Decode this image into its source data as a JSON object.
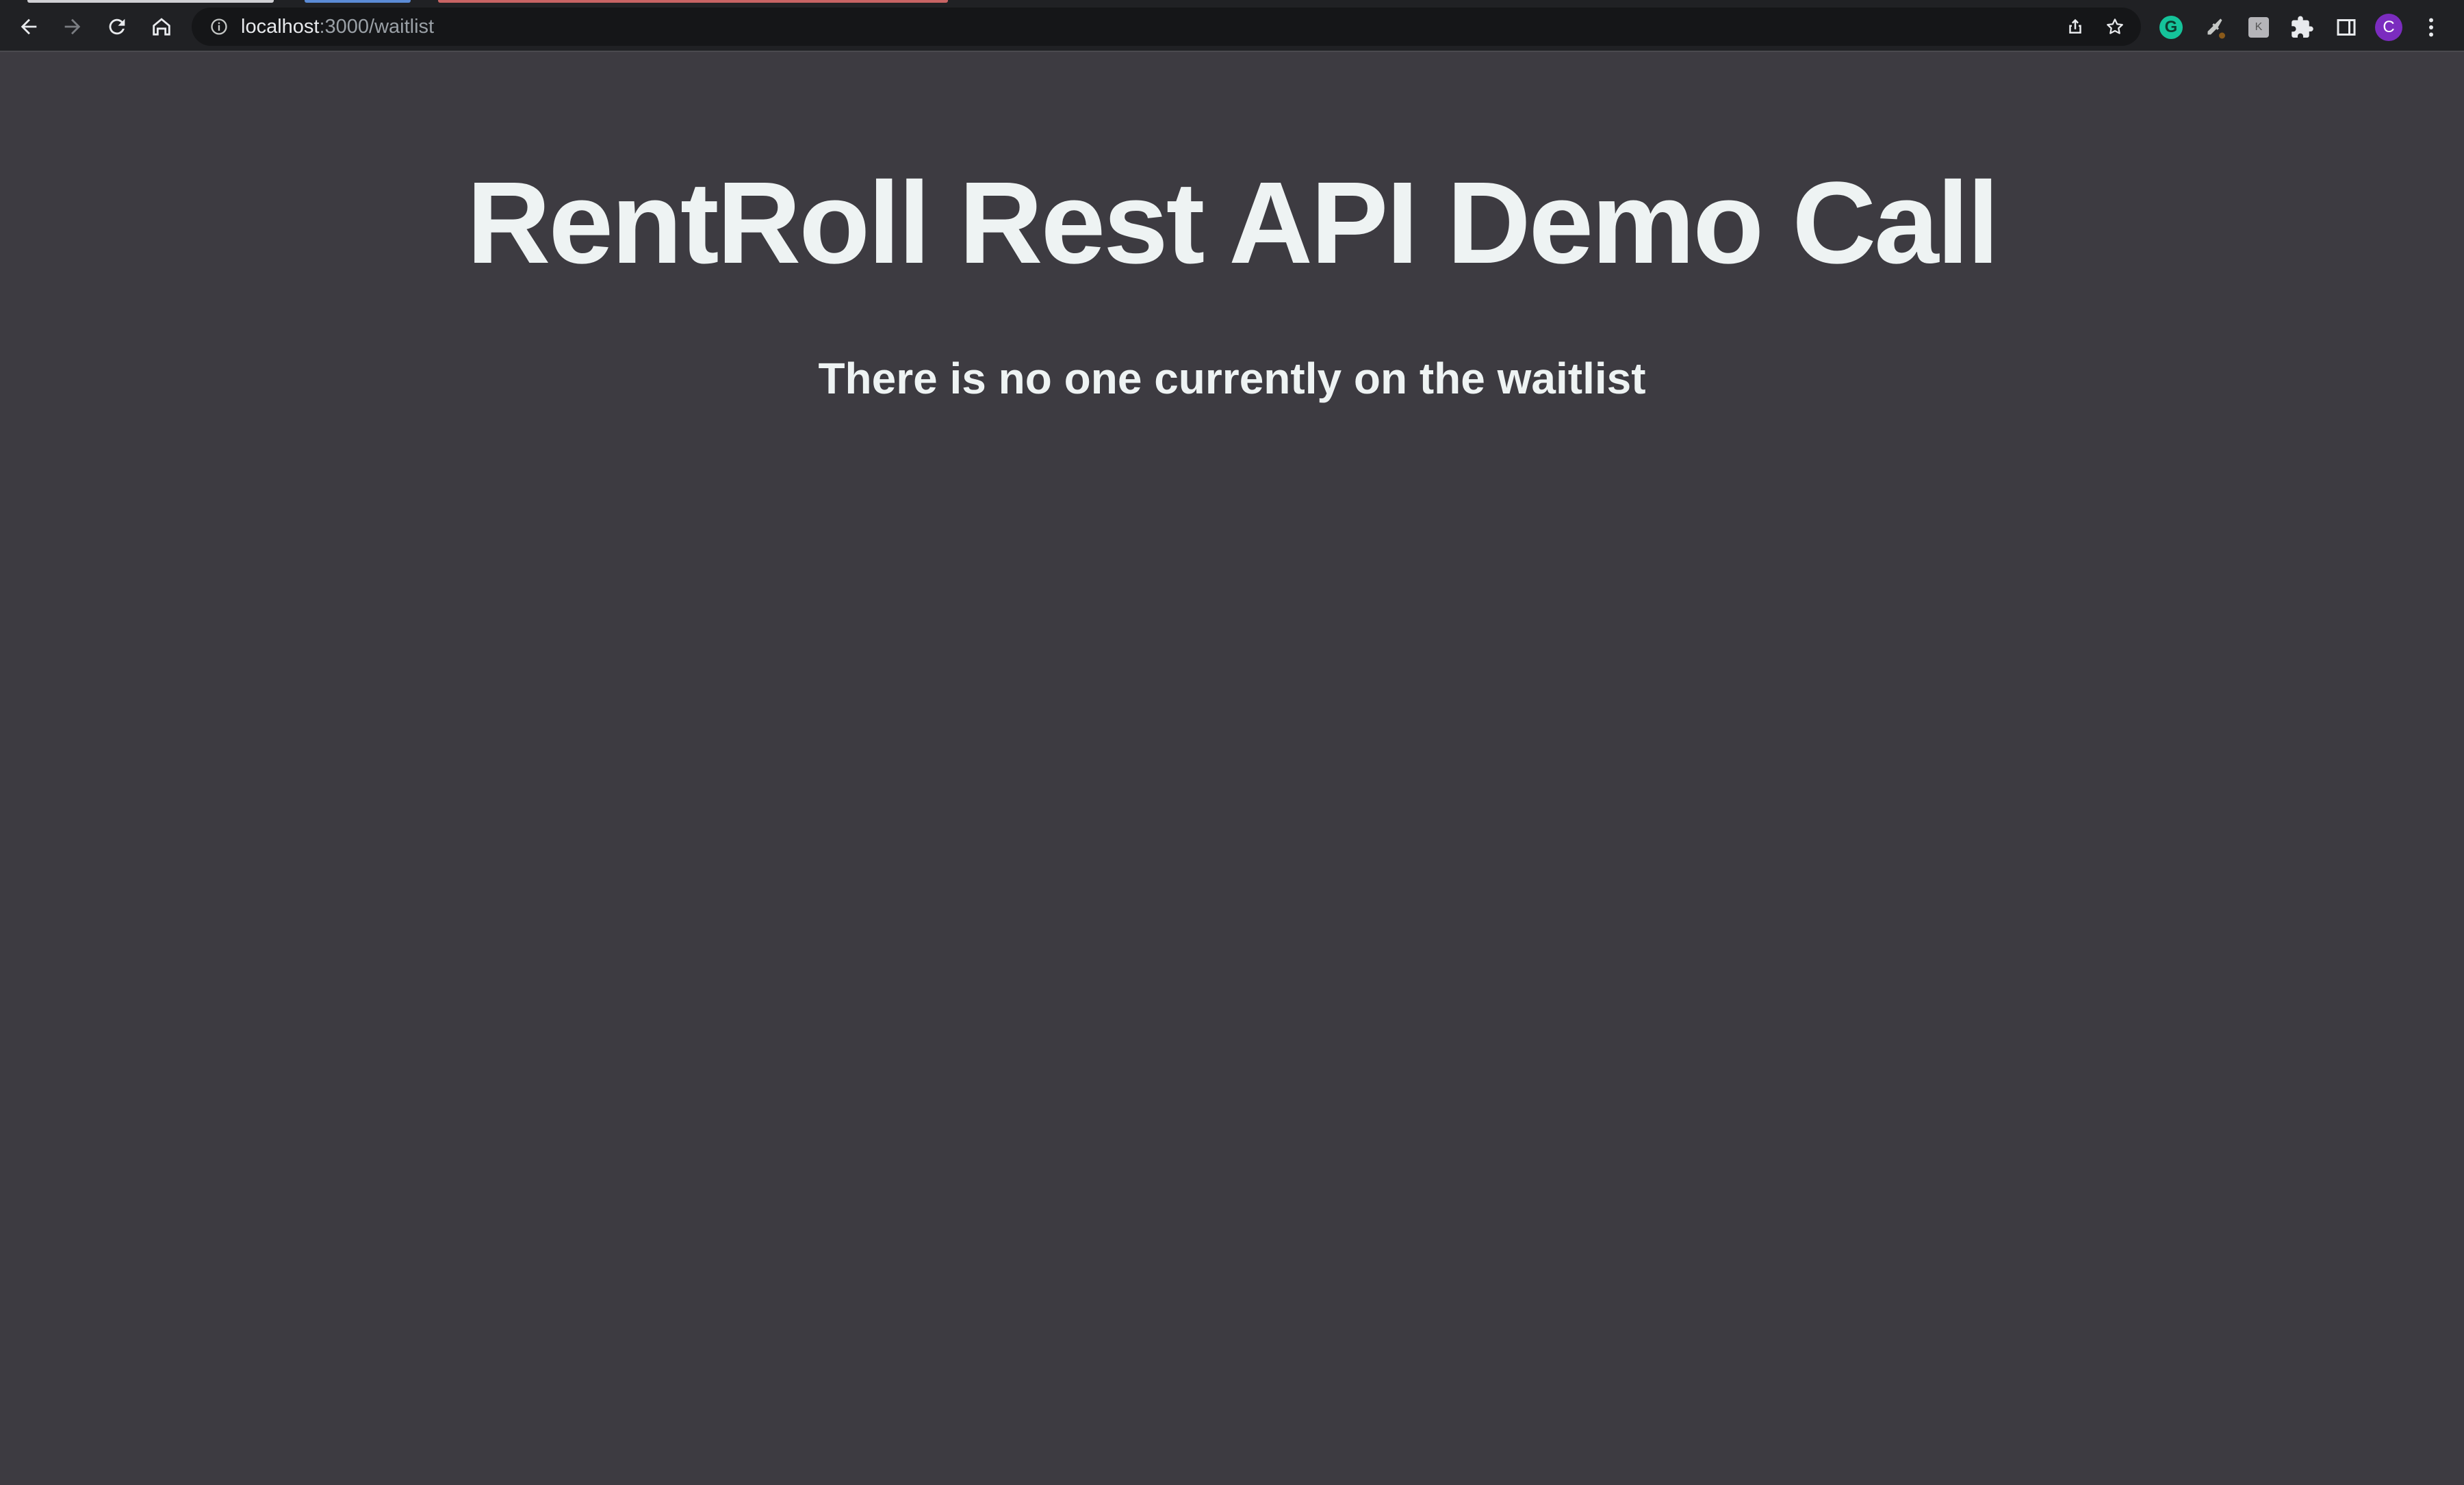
{
  "browser": {
    "url_host": "localhost",
    "url_path": ":3000/waitlist",
    "avatar_initial": "C",
    "grammarly_letter": "G",
    "colors": {
      "toolbar": "#202124",
      "omnibox": "#151618",
      "avatar": "#7b2cbf",
      "grammarly": "#15c39a"
    }
  },
  "page": {
    "title": "RentRoll Rest API Demo Call",
    "subtitle": "There is no one currently on the waitlist",
    "colors": {
      "background": "#3d3b41",
      "text": "#eef3f3"
    }
  }
}
